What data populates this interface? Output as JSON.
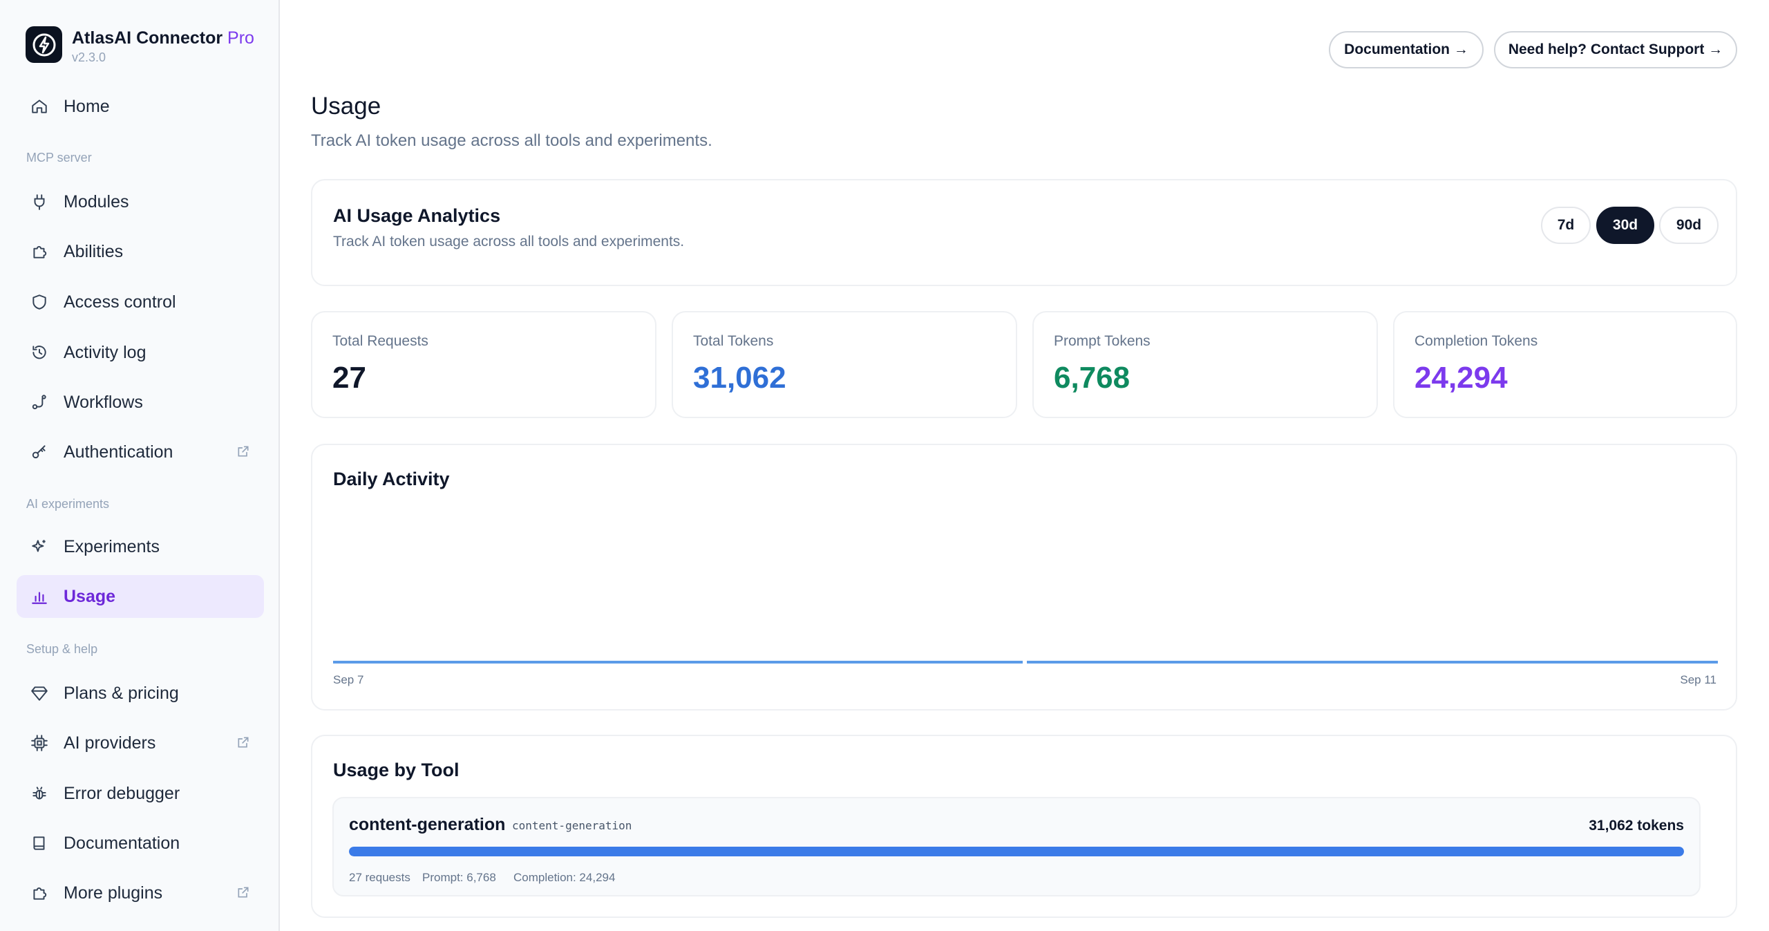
{
  "brand": {
    "name": "AtlasAI Connector",
    "tier": "Pro",
    "version": "v2.3.0"
  },
  "sidebar": {
    "home": {
      "label": "Home",
      "icon": "home-icon"
    },
    "section_mcp": "MCP server",
    "mcp_items": [
      {
        "label": "Modules",
        "icon": "plug-icon"
      },
      {
        "label": "Abilities",
        "icon": "puzzle-icon"
      },
      {
        "label": "Access control",
        "icon": "shield-icon"
      },
      {
        "label": "Activity log",
        "icon": "history-icon"
      },
      {
        "label": "Workflows",
        "icon": "workflow-icon"
      },
      {
        "label": "Authentication",
        "icon": "key-icon",
        "external": true
      }
    ],
    "section_ai": "AI experiments",
    "ai_items": [
      {
        "label": "Experiments",
        "icon": "sparkles-icon"
      },
      {
        "label": "Usage",
        "icon": "bar-chart-icon",
        "active": true
      }
    ],
    "section_setup": "Setup & help",
    "setup_items": [
      {
        "label": "Plans & pricing",
        "icon": "gem-icon"
      },
      {
        "label": "AI providers",
        "icon": "chip-icon",
        "external": true
      },
      {
        "label": "Error debugger",
        "icon": "bug-icon"
      },
      {
        "label": "Documentation",
        "icon": "book-icon"
      },
      {
        "label": "More plugins",
        "icon": "puzzle-icon",
        "external": true
      }
    ]
  },
  "header": {
    "docs_button": "Documentation →",
    "support_button": "Need help? Contact Support →"
  },
  "page": {
    "title": "Usage",
    "subtitle": "Track AI token usage across all tools and experiments."
  },
  "analytics": {
    "title": "AI Usage Analytics",
    "subtitle": "Track AI token usage across all tools and experiments.",
    "ranges": [
      "7d",
      "30d",
      "90d"
    ],
    "selected_range": "30d"
  },
  "stats": [
    {
      "label": "Total Requests",
      "value": "27",
      "color": "#0f172a"
    },
    {
      "label": "Total Tokens",
      "value": "31,062",
      "color": "#2f6fd6"
    },
    {
      "label": "Prompt Tokens",
      "value": "6,768",
      "color": "#0f8a5f"
    },
    {
      "label": "Completion Tokens",
      "value": "24,294",
      "color": "#7c3aed"
    }
  ],
  "daily_activity": {
    "title": "Daily Activity",
    "x_start": "Sep 7",
    "x_end": "Sep 11"
  },
  "usage_by_tool": {
    "title": "Usage by Tool",
    "tools": [
      {
        "name": "content-generation",
        "code": "content-generation",
        "tokens": "31,062 tokens",
        "share": 1.0,
        "requests": "27 requests",
        "prompt": "Prompt: 6,768",
        "completion": "Completion: 24,294"
      }
    ]
  },
  "colors": {
    "accent": "#7c3aed",
    "bar": "#3b7be8",
    "active_nav_bg": "#ede9fe"
  }
}
